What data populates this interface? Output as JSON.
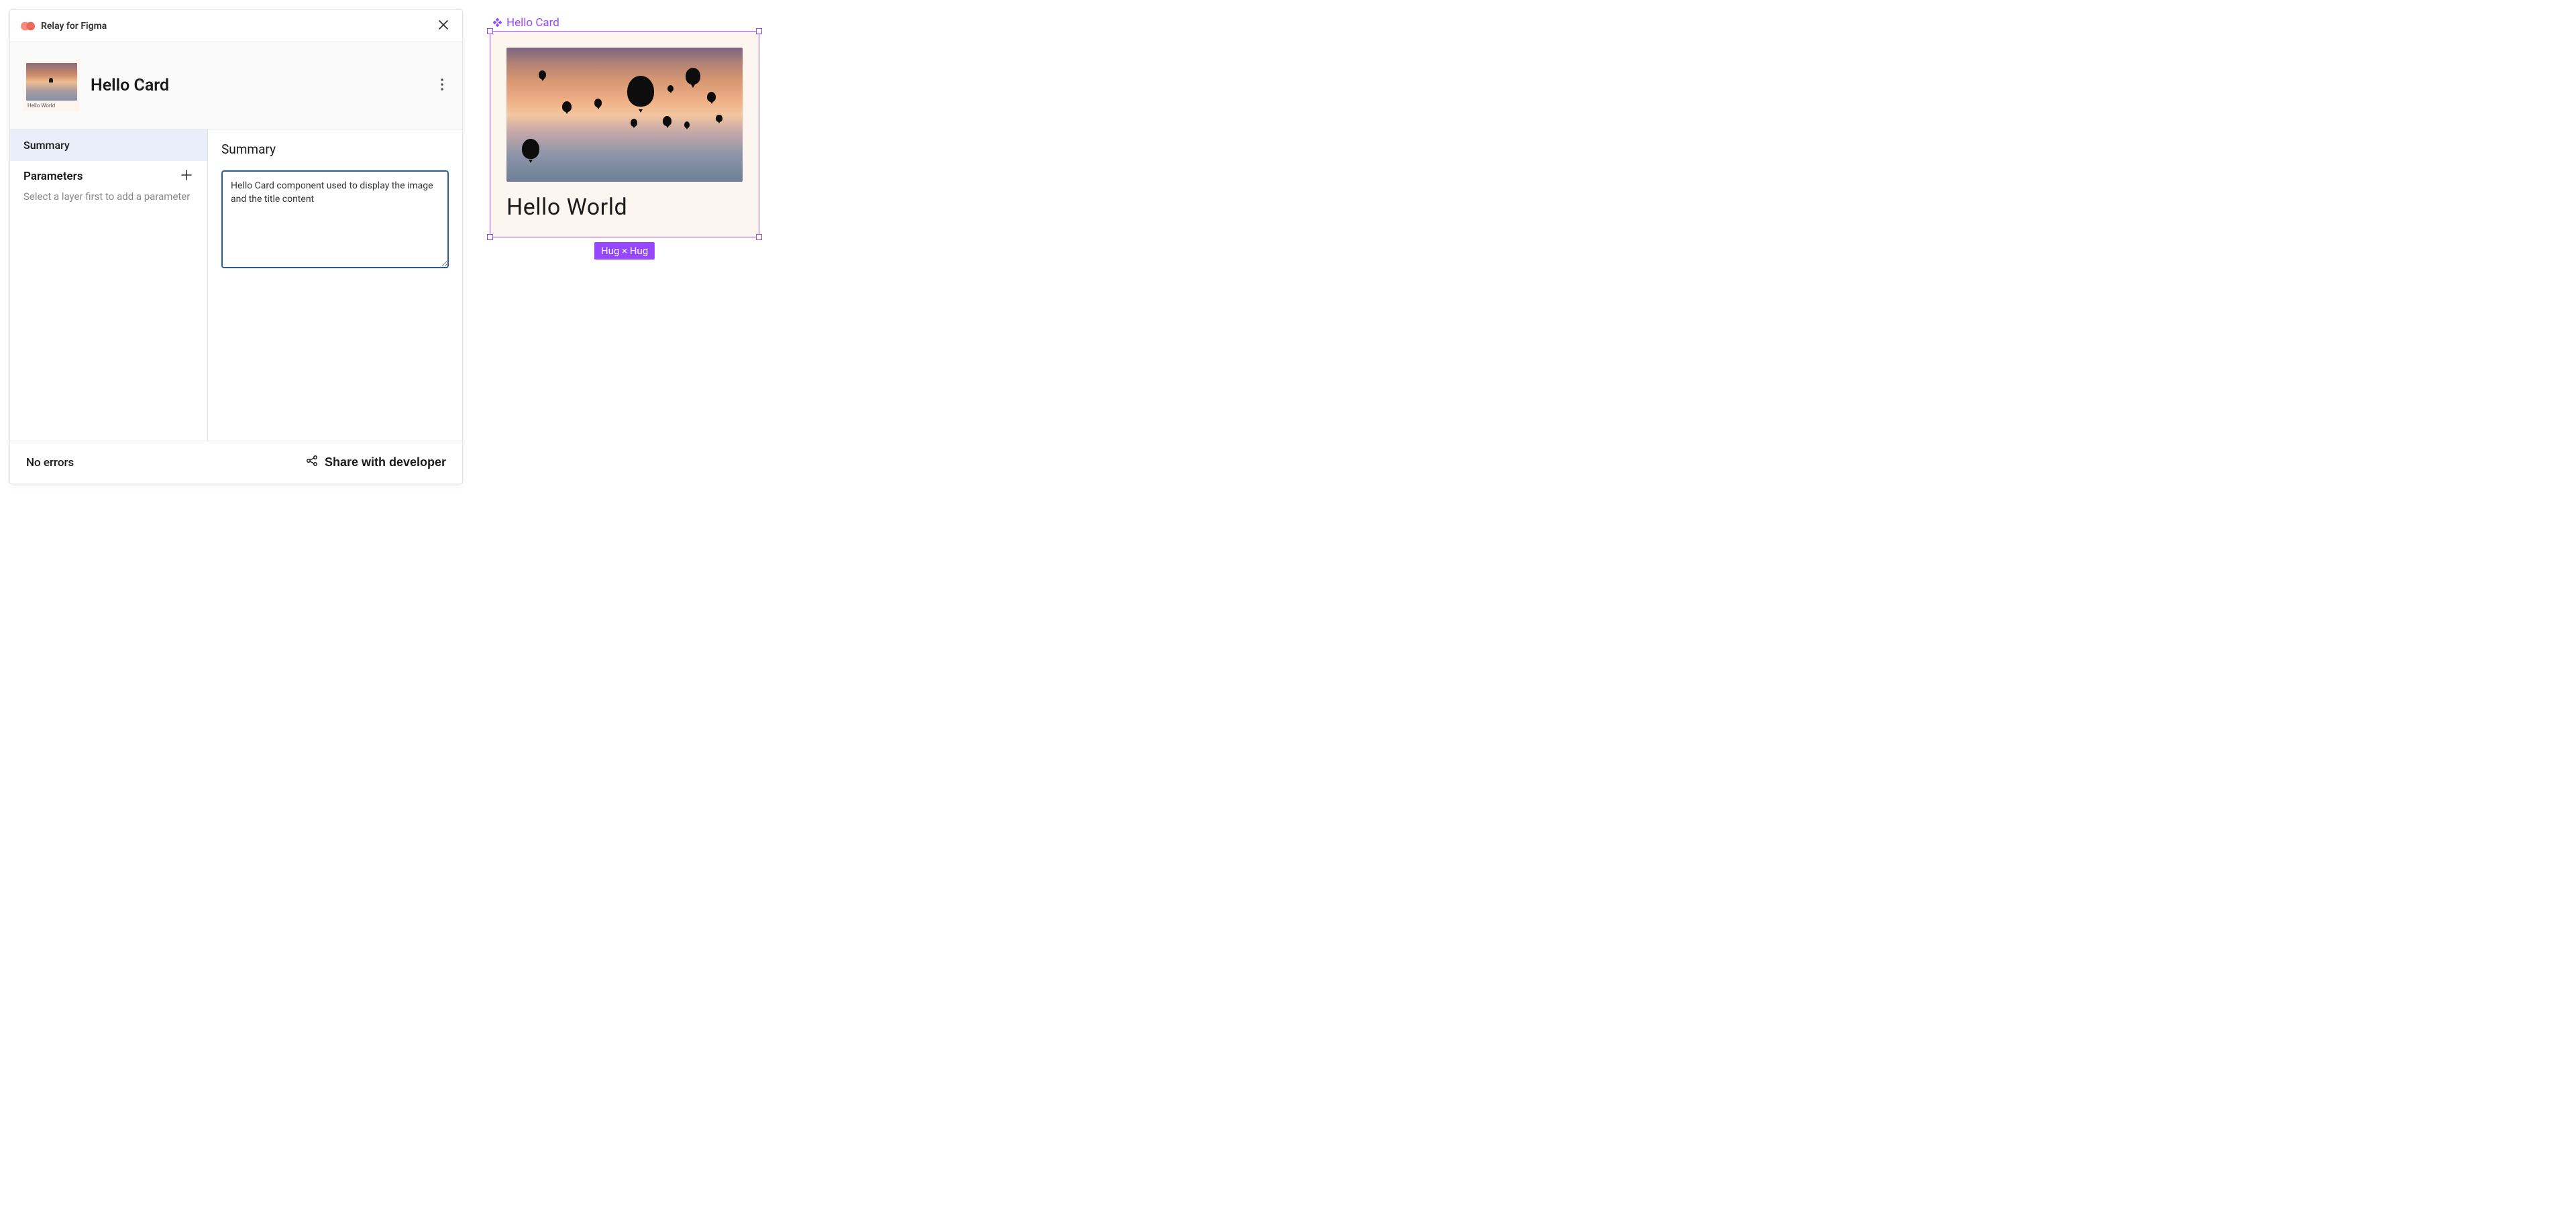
{
  "plugin": {
    "title": "Relay for Figma"
  },
  "component": {
    "name": "Hello Card",
    "thumbnail_caption": "Hello World"
  },
  "sidebar": {
    "summary_tab": "Summary",
    "parameters_title": "Parameters",
    "parameters_hint": "Select a layer first to add a parameter"
  },
  "content": {
    "heading": "Summary",
    "summary_text": "Hello Card component used to display the image and the title content"
  },
  "footer": {
    "errors": "No errors",
    "share_label": "Share with developer"
  },
  "canvas": {
    "frame_label": "Hello Card",
    "card_title": "Hello World",
    "size_badge": "Hug × Hug"
  },
  "colors": {
    "selection": "#9747ff",
    "focus_border": "#2c5f8d"
  }
}
